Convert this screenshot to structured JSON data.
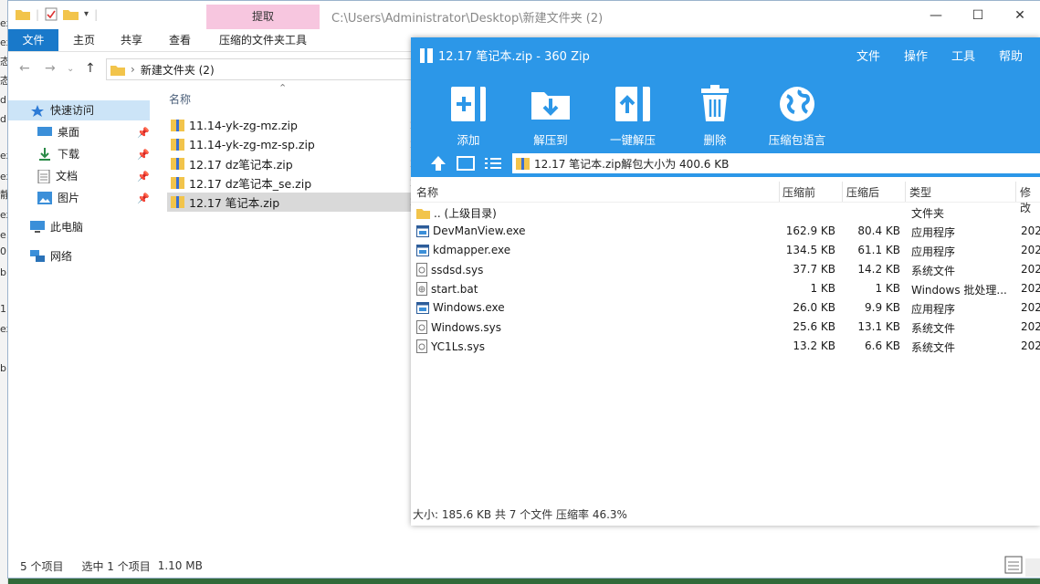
{
  "desktop": {
    "strip": [
      "ex",
      "ex",
      "态",
      "态",
      "d",
      "d",
      "ex",
      "ex",
      "静",
      "ex",
      "e.",
      "0",
      "b.",
      "1.",
      "ex",
      "b."
    ]
  },
  "explorer": {
    "title_path": "C:\\Users\\Administrator\\Desktop\\新建文件夹 (2)",
    "context_tab": "提取",
    "ribbon_tabs": [
      "文件",
      "主页",
      "共享",
      "查看",
      "压缩的文件夹工具"
    ],
    "address": "新建文件夹 (2)",
    "nav": {
      "quick_access": "快速访问",
      "items": [
        "桌面",
        "下载",
        "文档",
        "图片"
      ],
      "this_pc": "此电脑",
      "network": "网络"
    },
    "column_name": "名称",
    "files": [
      "11.14-yk-zg-mz.zip",
      "11.14-yk-zg-mz-sp.zip",
      "12.17 dz笔记本.zip",
      "12.17 dz笔记本_se.zip",
      "12.17 笔记本.zip"
    ],
    "right_edge": [
      "2",
      "2",
      "2",
      "2",
      "2"
    ],
    "status": {
      "count": "5 个项目",
      "selected": "选中 1 个项目",
      "size": "1.10 MB"
    }
  },
  "zip": {
    "title": "12.17 笔记本.zip - 360 Zip",
    "menu": [
      "文件",
      "操作",
      "工具",
      "帮助"
    ],
    "tools": [
      "添加",
      "解压到",
      "一键解压",
      "删除",
      "压缩包语言"
    ],
    "address": "12.17 笔记本.zip解包大小为 400.6 KB",
    "columns": [
      "名称",
      "压缩前",
      "压缩后",
      "类型",
      "修改"
    ],
    "rows": [
      {
        "name": ".. (上级目录)",
        "before": "",
        "after": "",
        "type": "文件夹",
        "mod": "",
        "icon": "folder"
      },
      {
        "name": "DevManView.exe",
        "before": "162.9 KB",
        "after": "80.4 KB",
        "type": "应用程序",
        "mod": "202",
        "icon": "exe"
      },
      {
        "name": "kdmapper.exe",
        "before": "134.5 KB",
        "after": "61.1 KB",
        "type": "应用程序",
        "mod": "202",
        "icon": "exe"
      },
      {
        "name": "ssdsd.sys",
        "before": "37.7 KB",
        "after": "14.2 KB",
        "type": "系统文件",
        "mod": "202",
        "icon": "sys"
      },
      {
        "name": "start.bat",
        "before": "1 KB",
        "after": "1 KB",
        "type": "Windows 批处理...",
        "mod": "202",
        "icon": "bat"
      },
      {
        "name": "Windows.exe",
        "before": "26.0 KB",
        "after": "9.9 KB",
        "type": "应用程序",
        "mod": "202",
        "icon": "exe"
      },
      {
        "name": "Windows.sys",
        "before": "25.6 KB",
        "after": "13.1 KB",
        "type": "系统文件",
        "mod": "202",
        "icon": "sys"
      },
      {
        "name": "YC1Ls.sys",
        "before": "13.2 KB",
        "after": "6.6 KB",
        "type": "系统文件",
        "mod": "202",
        "icon": "sys"
      }
    ],
    "status": "大小: 185.6 KB 共 7 个文件 压缩率 46.3%"
  },
  "colors": {
    "explorer_file_tab": "#1979ca",
    "zip_blue": "#2c97e8",
    "ctx_pink": "#f7c6df",
    "selection": "#cce4f7"
  }
}
